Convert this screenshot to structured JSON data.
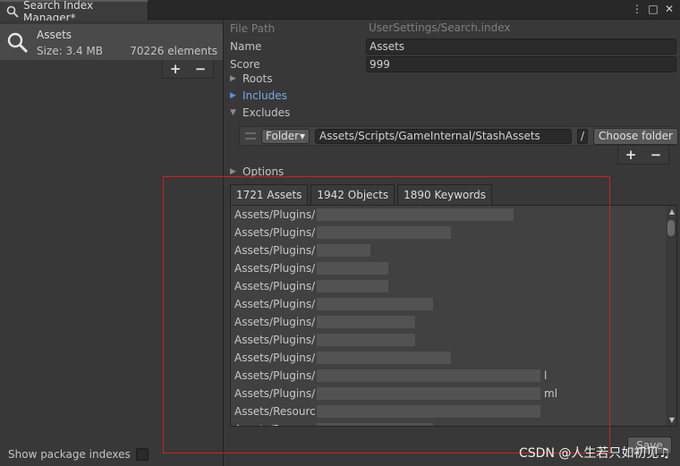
{
  "window": {
    "tab_title": "Search Index Manager*",
    "icons": [
      "more-vert-icon",
      "maximize-icon",
      "close-icon"
    ]
  },
  "left": {
    "index": {
      "name": "Assets",
      "size": "Size: 3.4 MB",
      "count": "70226 elements"
    },
    "add": "+",
    "remove": "−",
    "show_packages": "Show package indexes",
    "show_packages_checked": false
  },
  "details": {
    "file_path_label": "File Path",
    "file_path_value": "UserSettings/Search.index",
    "name_label": "Name",
    "name_value": "Assets",
    "score_label": "Score",
    "score_value": "999",
    "roots_label": "Roots",
    "includes_label": "Includes",
    "excludes_label": "Excludes",
    "options_label": "Options",
    "exclude_entry": {
      "type": "Folder",
      "path": "Assets/Scripts/GameInternal/StashAssets",
      "slash": "/",
      "choose": "Choose folder"
    },
    "add": "+",
    "remove": "−"
  },
  "tabs": [
    "1721 Assets",
    "1942 Objects",
    "1890 Keywords"
  ],
  "list_items": [
    "Assets/Plugins/",
    "Assets/Plugins/",
    "Assets/Plugins/",
    "Assets/Plugins/",
    "Assets/Plugins/",
    "Assets/Plugins/",
    "Assets/Plugins/",
    "Assets/Plugins/",
    "Assets/Plugins/",
    "Assets/Plugins/",
    "Assets/Plugins/",
    "Assets/Resourc",
    "Assets/Resourc"
  ],
  "list_item_suffixes": [
    "",
    "",
    "",
    "",
    "",
    "",
    "",
    "",
    "",
    "l",
    "ml",
    "",
    ""
  ],
  "save": "Save",
  "watermark": "CSDN @人生若只如初见♫",
  "colors": {
    "accent_blue": "#7aa8e8",
    "highlight_box": "#d11f1f",
    "background": "#383838"
  }
}
